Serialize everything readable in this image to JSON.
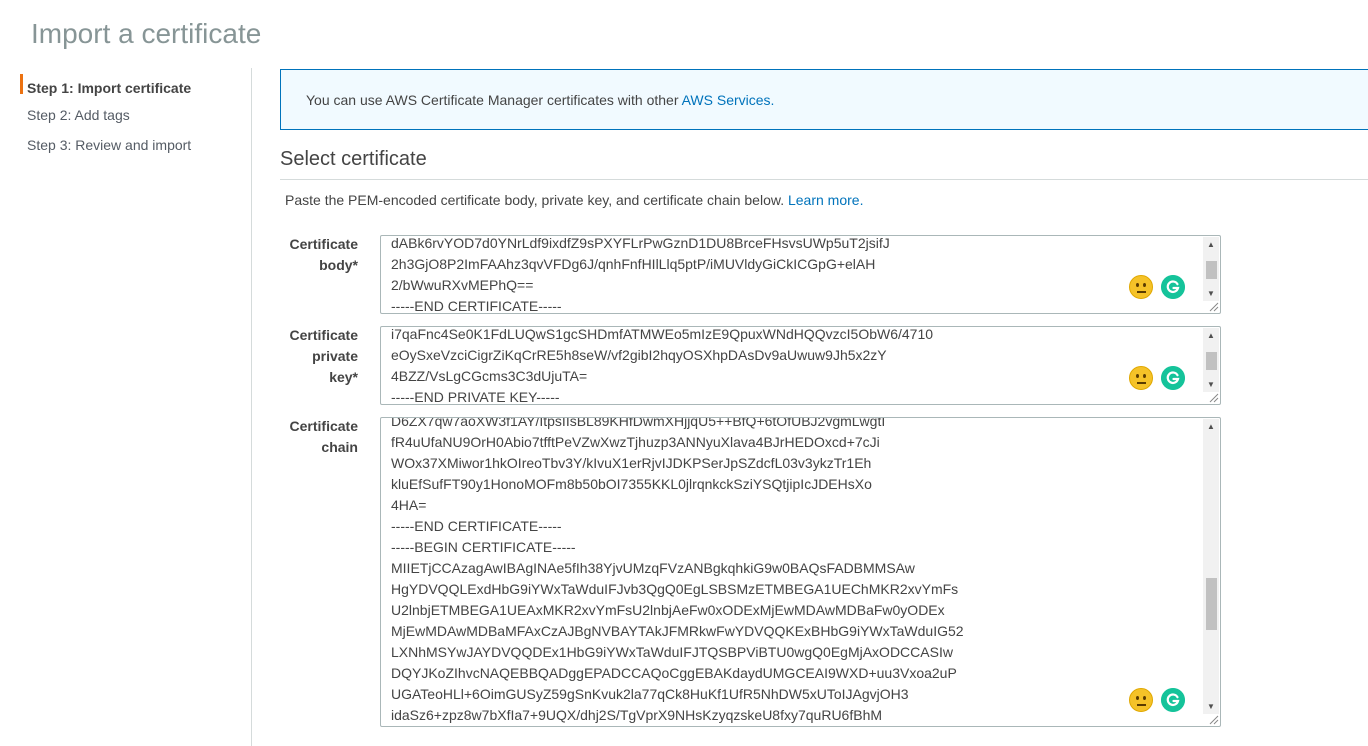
{
  "page": {
    "title": "Import a certificate"
  },
  "steps": [
    {
      "label": "Step 1: Import certificate"
    },
    {
      "label": "Step 2: Add tags"
    },
    {
      "label": "Step 3: Review and import"
    }
  ],
  "info": {
    "text": "You can use AWS Certificate Manager certificates with other ",
    "link": "AWS Services."
  },
  "section": {
    "title": "Select certificate",
    "description": "Paste the PEM-encoded certificate body, private key, and certificate chain below. ",
    "learn_more": "Learn more."
  },
  "fields": {
    "body": {
      "label_line1": "Certificate",
      "label_line2": "body*",
      "lines": [
        "dABk6rvYOD7d0YNrLdf9ixdfZ9sPXYFLrPwGznD1DU8BrceFHsvsUWp5uT2jsifJ",
        "2h3GjO8P2ImFAAhz3qvVFDg6J/qnhFnfHIlLlq5ptP/iMUVldyGiCkICGpG+elAH",
        "2/bWwuRXvMEPhQ==",
        "-----END CERTIFICATE-----"
      ]
    },
    "private_key": {
      "label_line1": "Certificate",
      "label_line2": "private",
      "label_line3": "key*",
      "lines": [
        "i7qaFnc4Se0K1FdLUQwS1gcSHDmfATMWEo5mIzE9QpuxWNdHQQvzcI5ObW6/4710",
        "eOySxeVzciCigrZiKqCrRE5h8seW/vf2gibI2hqyOSXhpDAsDv9aUwuw9Jh5x2zY",
        "4BZZ/VsLgCGcms3C3dUjuTA=",
        "-----END PRIVATE KEY-----"
      ]
    },
    "chain": {
      "label_line1": "Certificate",
      "label_line2": "chain",
      "lines": [
        "D6ZX7qw7aoXW3f1AY/ItpsIIsBL89KHfDwmXHjjqU5++BfQ+6tOfUBJ2vgmLwgtI",
        "fR4uUfaNU9OrH0Abio7tfftPeVZwXwzTjhuzp3ANNyuXlava4BJrHEDOxcd+7cJi",
        "WOx37XMiwor1hkOIreoTbv3Y/kIvuX1erRjvIJDKPSerJpSZdcfL03v3ykzTr1Eh",
        "kluEfSufFT90y1HonoMOFm8b50bOI7355KKL0jlrqnkckSziYSQtjipIcJDEHsXo",
        "4HA=",
        "-----END CERTIFICATE-----",
        "-----BEGIN CERTIFICATE-----",
        "MIIETjCCAzagAwIBAgINAe5fIh38YjvUMzqFVzANBgkqhkiG9w0BAQsFADBMMSAw",
        "HgYDVQQLExdHbG9iYWxTaWduIFJvb3QgQ0EgLSBSMzETMBEGA1UEChMKR2xvYmFs",
        "U2lnbjETMBEGA1UEAxMKR2xvYmFsU2lnbjAeFw0xODExMjEwMDAwMDBaFw0yODEx",
        "MjEwMDAwMDBaMFAxCzAJBgNVBAYTAkJFMRkwFwYDVQQKExBHbG9iYWxTaWduIG52",
        "LXNhMSYwJAYDVQQDEx1HbG9iYWxTaWduIFJTQSBPViBTU0wgQ0EgMjAxODCCASIw",
        "DQYJKoZIhvcNAQEBBQADggEPADCCAQoCggEBAKdaydUMGCEAI9WXD+uu3Vxoa2uP",
        "UGATeoHLl+6OimGUSyZ59gSnKvuk2la77qCk8HuKf1UfR5NhDW5xUToIJAgvjOH3",
        "idaSz6+zpz8w7bXfIa7+9UQX/dhj2S/TgVprX9NHsKzyqzskeU8fxy7quRU6fBhM"
      ]
    }
  },
  "colors": {
    "accent": "#ec7211",
    "link": "#0073bb",
    "info_bg": "#f1faff",
    "grammarly": "#15c39a",
    "emoji": "#f5c228"
  },
  "icons": {
    "emoji": "neutral-face-icon",
    "grammarly": "grammarly-icon"
  }
}
